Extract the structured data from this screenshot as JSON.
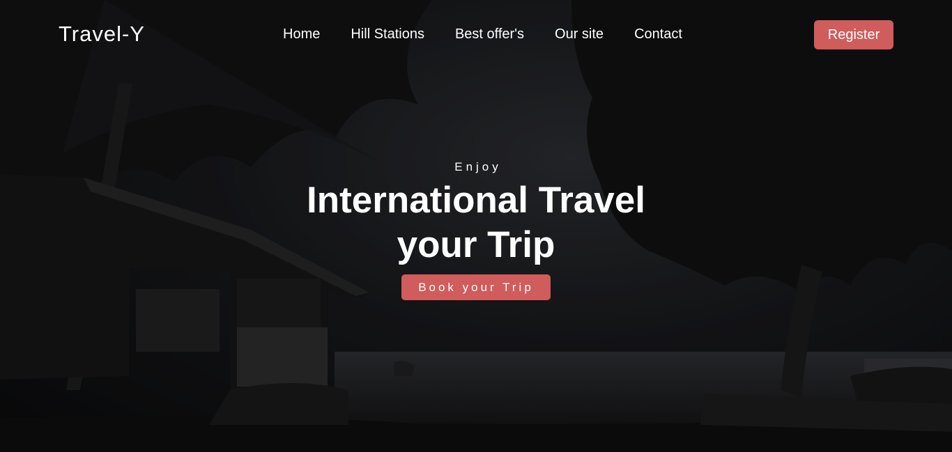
{
  "brand": {
    "logo_text": "Travel-Y"
  },
  "nav": {
    "items": [
      {
        "label": "Home"
      },
      {
        "label": "Hill Stations"
      },
      {
        "label": "Best offer's"
      },
      {
        "label": "Our site"
      },
      {
        "label": "Contact"
      }
    ],
    "register_label": "Register"
  },
  "hero": {
    "eyebrow": "Enjoy",
    "headline_line1": "International Travel",
    "headline_line2": "your Trip",
    "cta_label": "Book your Trip"
  },
  "colors": {
    "accent": "#d05c5c",
    "text": "#ffffff",
    "background": "#0b0b0c"
  }
}
